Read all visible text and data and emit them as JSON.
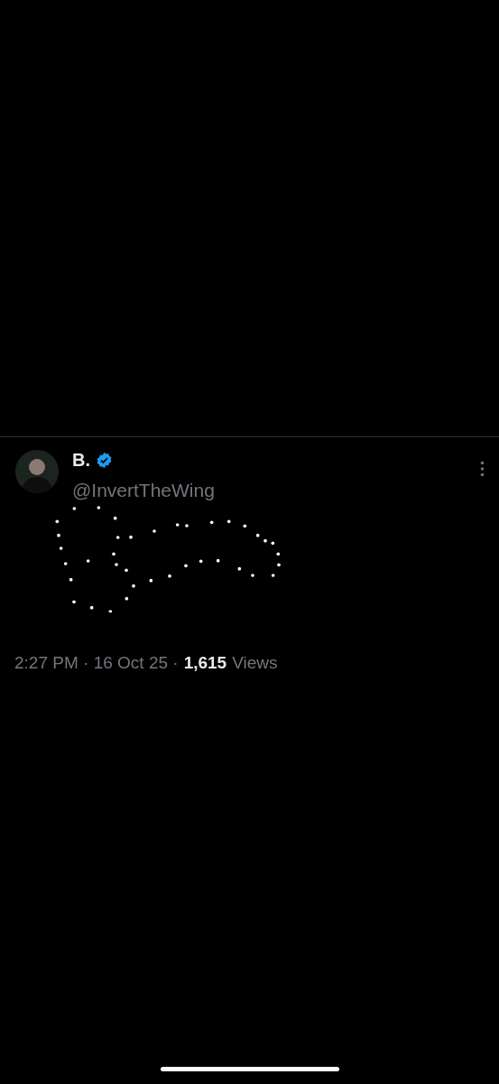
{
  "tweet": {
    "display_name": "B.",
    "verified": true,
    "handle": "@InvertTheWing",
    "timestamp": "2:27 PM · 16 Oct 25 ·",
    "views_count": "1,615",
    "views_label": "Views"
  }
}
